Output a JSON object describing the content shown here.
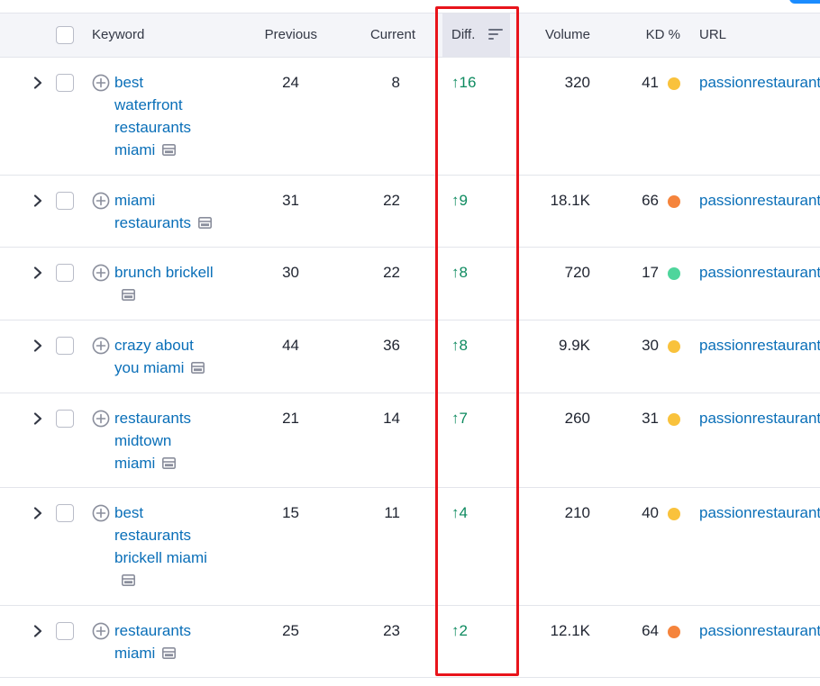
{
  "header": {
    "keyword": "Keyword",
    "previous": "Previous",
    "current": "Current",
    "diff": "Diff.",
    "volume": "Volume",
    "kd": "KD %",
    "url": "URL"
  },
  "kd_colors": {
    "yellow": "#f9c23c",
    "orange": "#f5843c",
    "green": "#4fd59c"
  },
  "accent": {
    "link": "#0a6fb8",
    "positive": "#0d8a5f",
    "highlight": "#e8141b"
  },
  "rows": [
    {
      "keyword": "best waterfront restaurants miami",
      "previous": "24",
      "current": "8",
      "diff": "16",
      "volume": "320",
      "kd": "41",
      "kd_level": "yellow",
      "url": "passionrestaurant"
    },
    {
      "keyword": "miami restaurants",
      "previous": "31",
      "current": "22",
      "diff": "9",
      "volume": "18.1K",
      "kd": "66",
      "kd_level": "orange",
      "url": "passionrestaurant"
    },
    {
      "keyword": "brunch brickell",
      "previous": "30",
      "current": "22",
      "diff": "8",
      "volume": "720",
      "kd": "17",
      "kd_level": "green",
      "url": "passionrestaurant"
    },
    {
      "keyword": "crazy about you miami",
      "previous": "44",
      "current": "36",
      "diff": "8",
      "volume": "9.9K",
      "kd": "30",
      "kd_level": "yellow",
      "url": "passionrestaurant"
    },
    {
      "keyword": "restaurants midtown miami",
      "previous": "21",
      "current": "14",
      "diff": "7",
      "volume": "260",
      "kd": "31",
      "kd_level": "yellow",
      "url": "passionrestaurant"
    },
    {
      "keyword": "best restaurants brickell miami",
      "previous": "15",
      "current": "11",
      "diff": "4",
      "volume": "210",
      "kd": "40",
      "kd_level": "yellow",
      "url": "passionrestaurant"
    },
    {
      "keyword": "restaurants miami",
      "previous": "25",
      "current": "23",
      "diff": "2",
      "volume": "12.1K",
      "kd": "64",
      "kd_level": "orange",
      "url": "passionrestaurant"
    }
  ]
}
